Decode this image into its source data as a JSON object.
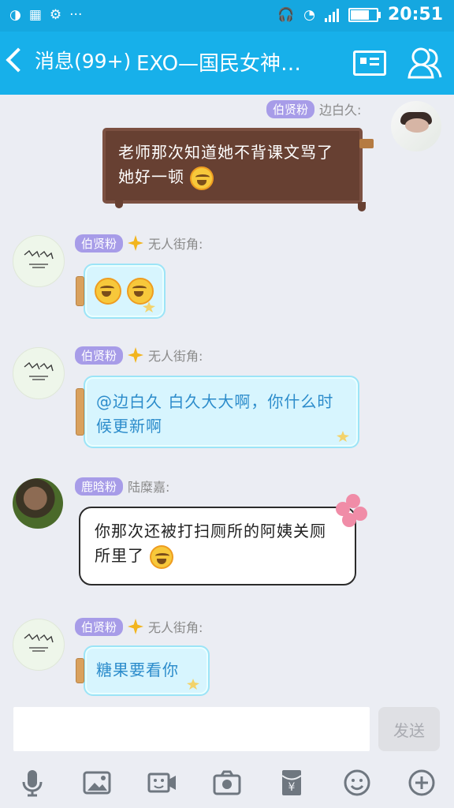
{
  "status_bar": {
    "time": "20:51",
    "battery_level": 0.72
  },
  "nav": {
    "back_label": "消息(99+)",
    "title": "EXO—国民女神…"
  },
  "messages": [
    {
      "tag": "伯贤粉",
      "sender": "边白久:",
      "text": "老师那次知道她不背课文骂了她好一顿",
      "bubble": "chocolate",
      "side": "right"
    },
    {
      "tag": "伯贤粉",
      "sender": "无人街角:",
      "text": "",
      "bubble": "jar",
      "side": "left"
    },
    {
      "tag": "伯贤粉",
      "sender": "无人街角:",
      "text": "@边白久 白久大大啊，你什么时候更新啊",
      "bubble": "jar",
      "side": "left"
    },
    {
      "tag": "鹿晗粉",
      "sender": "陆糜嘉:",
      "text": "你那次还被打扫厕所的阿姨关厕所里了",
      "bubble": "white",
      "side": "left"
    },
    {
      "tag": "伯贤粉",
      "sender": "无人街角:",
      "text": "糖果要看你",
      "bubble": "jar",
      "side": "left"
    }
  ],
  "input": {
    "placeholder": "",
    "value": ""
  },
  "send_label": "发送",
  "toolbar": [
    "microphone-icon",
    "image-icon",
    "video-call-icon",
    "camera-icon",
    "red-packet-icon",
    "emoji-icon",
    "plus-icon"
  ],
  "colors": {
    "header": "#17b0ea",
    "tag": "#a79ce8",
    "jar_text": "#2c8ccb"
  }
}
